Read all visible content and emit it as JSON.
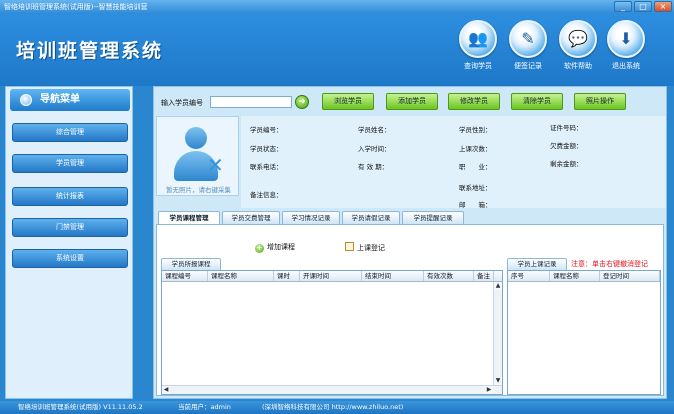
{
  "window": {
    "title": "智络培训班管理系统(试用版)--智慧技能培训营",
    "min": "_",
    "max": "□",
    "close": "×"
  },
  "header": {
    "app_title": "培训班管理系统",
    "buttons": [
      {
        "label": "查询学员",
        "icon": "students-query-icon",
        "glyph": "👥"
      },
      {
        "label": "便签记录",
        "icon": "pen-note-icon",
        "glyph": "✎"
      },
      {
        "label": "软件帮助",
        "icon": "help-chat-icon",
        "glyph": "💬"
      },
      {
        "label": "退出系统",
        "icon": "exit-arrow-icon",
        "glyph": "⬇"
      }
    ]
  },
  "nav": {
    "title": "导航菜单",
    "items": [
      "综合管理",
      "学员管理",
      "统计报表",
      "门禁管理",
      "系统设置"
    ]
  },
  "search": {
    "label": "输入学员编号",
    "value": "",
    "go": "➜"
  },
  "actions": [
    "浏览学员",
    "添加学员",
    "修改学员",
    "清除学员",
    "照片操作"
  ],
  "photo": {
    "caption": "暂无照片，请右键采集"
  },
  "info": {
    "student_no": "学员编号：",
    "student_name": "学员姓名：",
    "student_gender": "学员性别：",
    "id_no": "证件号码：",
    "student_status": "学员状态：",
    "enroll_time": "入学时间：",
    "class_count": "上课次数：",
    "arrears": "欠费金额：",
    "phone": "联系电话：",
    "valid_period": "有 效 期：",
    "occupation": "职　　业：",
    "balance": "剩余金额：",
    "notes": "备注信息：",
    "address": "联系地址：",
    "email": "邮　　箱："
  },
  "tabs": [
    "学员课程管理",
    "学员交费管理",
    "学习情况记录",
    "学员请假记录",
    "学员提醒记录"
  ],
  "course_tab": {
    "add_course": "增加课程",
    "register_class": "上课登记",
    "courses_caption": "学员所报课程",
    "course_columns": [
      "课程编号",
      "课程名称",
      "课时",
      "开课时间",
      "结束时间",
      "有效次数",
      "备注"
    ],
    "attendance_caption": "学员上课记录",
    "attendance_notice": "注意：单击右键撤消登记",
    "attendance_columns": [
      "序号",
      "课程名称",
      "登记时间"
    ]
  },
  "status": {
    "version": "智络培训班管理系统(试用版) V11.11.05.2",
    "current_user": "当前用户：admin",
    "company": "(深圳智络科技有限公司 http://www.zhiluo.net)"
  }
}
